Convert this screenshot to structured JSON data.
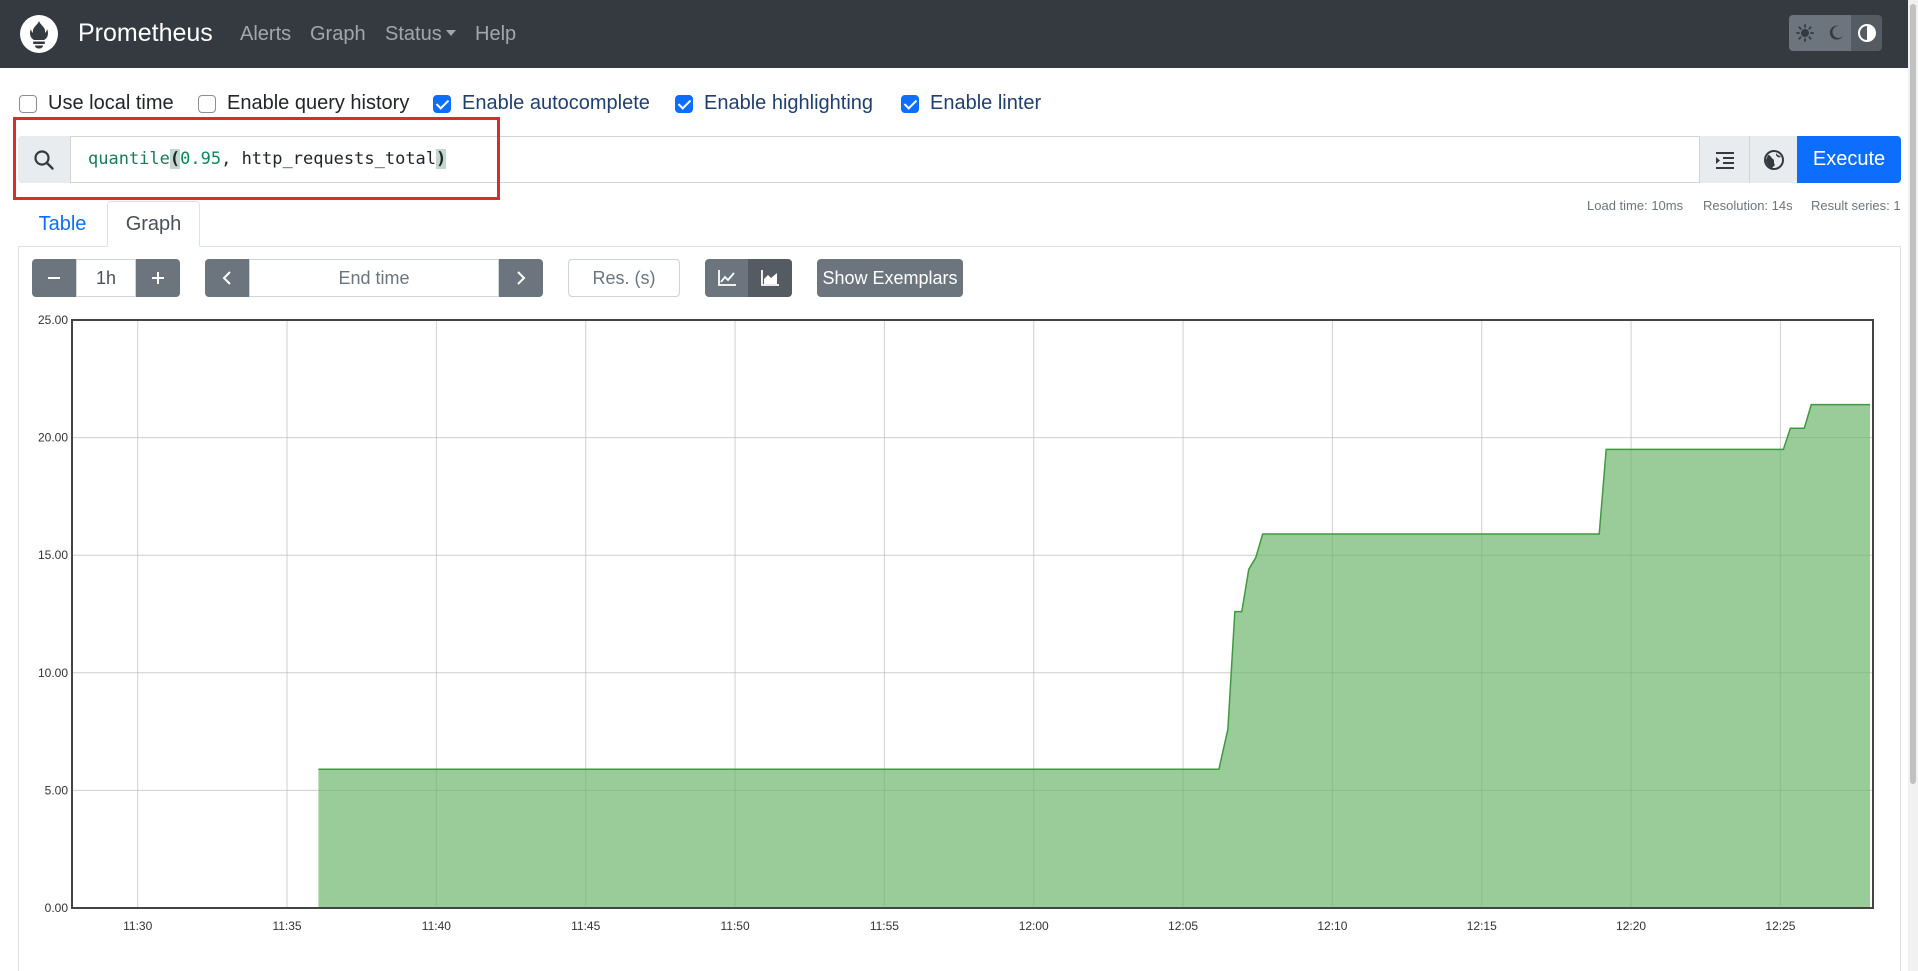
{
  "navbar": {
    "brand": "Prometheus",
    "links": {
      "alerts": "Alerts",
      "graph": "Graph",
      "status": "Status",
      "help": "Help"
    }
  },
  "options": {
    "use_local_time": {
      "label": "Use local time",
      "checked": false
    },
    "enable_query_history": {
      "label": "Enable query history",
      "checked": false
    },
    "enable_autocomplete": {
      "label": "Enable autocomplete",
      "checked": true
    },
    "enable_highlighting": {
      "label": "Enable highlighting",
      "checked": true
    },
    "enable_linter": {
      "label": "Enable linter",
      "checked": true
    }
  },
  "query": {
    "fn": "quantile",
    "open_paren": "(",
    "number": "0.95",
    "rest": ", http_requests_total",
    "close_paren": ")",
    "execute_label": "Execute"
  },
  "stats": {
    "load_time": "Load time: 10ms",
    "resolution": "Resolution: 14s",
    "result_series": "Result series: 1"
  },
  "tabs": {
    "table": "Table",
    "graph": "Graph"
  },
  "controls": {
    "range": "1h",
    "end_time_placeholder": "End time",
    "resolution_placeholder": "Res. (s)",
    "show_exemplars": "Show Exemplars"
  },
  "icons": {
    "logo": "prometheus-flame-icon",
    "search": "search-icon",
    "format": "format-indent-icon",
    "metrics_explorer": "globe-icon",
    "theme_light": "sun-icon",
    "theme_dark": "moon-icon",
    "theme_auto": "half-circle-icon",
    "range_minus": "minus-icon",
    "range_plus": "plus-icon",
    "prev": "chevron-left-icon",
    "next": "chevron-right-icon",
    "line_chart": "line-chart-icon",
    "area_chart": "area-chart-icon"
  },
  "colors": {
    "navbar_bg": "#343a40",
    "primary": "#0d6efd",
    "series_fill": "#99cc99",
    "series_line": "#3f9a3f",
    "highlight": "#d32f2f"
  },
  "chart_data": {
    "type": "area",
    "title": "",
    "xlabel": "",
    "ylabel": "",
    "x_ticks": [
      "11:30",
      "11:35",
      "11:40",
      "11:45",
      "11:50",
      "11:55",
      "12:00",
      "12:05",
      "12:10",
      "12:15",
      "12:20",
      "12:25"
    ],
    "y_ticks": [
      "0.00",
      "5.00",
      "10.00",
      "15.00",
      "20.00",
      "25.00"
    ],
    "ylim": [
      0,
      25
    ],
    "xlim": [
      "11:27:50",
      "11:28:00"
    ],
    "x_range_minutes": [
      -2.2,
      58.1
    ],
    "grid": true,
    "series": [
      {
        "points": [
          [
            "11:36:03",
            5.9
          ],
          [
            "12:06:12",
            5.9
          ],
          [
            "12:06:30",
            7.6
          ],
          [
            "12:06:44",
            12.6
          ],
          [
            "12:06:58",
            12.6
          ],
          [
            "12:07:12",
            14.4
          ],
          [
            "12:07:26",
            14.9
          ],
          [
            "12:07:40",
            15.9
          ],
          [
            "12:18:56",
            15.9
          ],
          [
            "12:19:10",
            19.5
          ],
          [
            "12:25:06",
            19.5
          ],
          [
            "12:25:20",
            20.4
          ],
          [
            "12:25:48",
            20.4
          ],
          [
            "12:26:02",
            21.4
          ],
          [
            "12:28:00",
            21.4
          ]
        ]
      }
    ]
  }
}
